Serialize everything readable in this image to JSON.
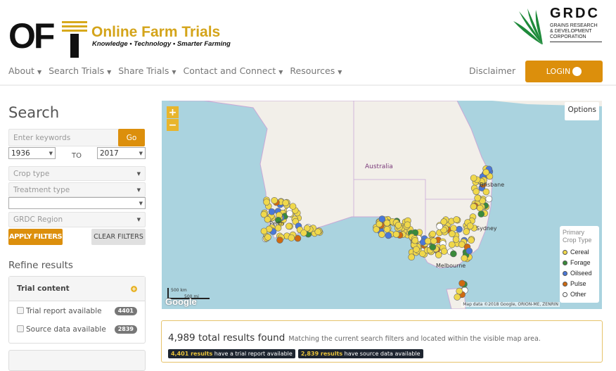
{
  "header": {
    "logo_text": "OFT",
    "title": "Online Farm Trials",
    "tagline": "Knowledge • Technology • Smarter Farming",
    "partner": {
      "name": "GRDC",
      "subtitle": [
        "GRAINS RESEARCH",
        "& DEVELOPMENT",
        "CORPORATION"
      ]
    }
  },
  "nav": {
    "items": [
      {
        "label": "About"
      },
      {
        "label": "Search Trials"
      },
      {
        "label": "Share Trials"
      },
      {
        "label": "Contact and Connect"
      },
      {
        "label": "Resources"
      }
    ],
    "disclaimer": "Disclaimer",
    "login": "LOGIN"
  },
  "search": {
    "title": "Search",
    "keyword_placeholder": "Enter keywords",
    "go": "Go",
    "year_from": "1936",
    "to_label": "TO",
    "year_to": "2017",
    "crop_type": "Crop type",
    "treatment_type": "Treatment type",
    "blank_select": "",
    "region": "GRDC Region",
    "apply": "APPLY FILTERS",
    "clear": "CLEAR FILTERS"
  },
  "refine": {
    "title": "Refine results",
    "panel_title": "Trial content",
    "options": [
      {
        "label": "Trial report available",
        "count": "4401"
      },
      {
        "label": "Source data available",
        "count": "2839"
      }
    ]
  },
  "map": {
    "zoom_in": "+",
    "zoom_out": "−",
    "options": "Options",
    "labels": {
      "country": "Australia",
      "perth": "Perth",
      "brisbane": "Brisbane",
      "sydney": "Sydney",
      "melbourne": "Melbourne"
    },
    "scale_km": "500 km",
    "scale_mi": "500 mi",
    "google": "Google",
    "attribution": "Map data ©2018 Google, ORION-ME, ZENRIN",
    "legend": {
      "title": "Primary Crop Type",
      "items": [
        {
          "label": "Cereal",
          "color": "#f0d84a"
        },
        {
          "label": "Forage",
          "color": "#3a8a3a"
        },
        {
          "label": "Oilseed",
          "color": "#4a78d8"
        },
        {
          "label": "Pulse",
          "color": "#d06a10"
        },
        {
          "label": "Other",
          "color": "#ffffff"
        }
      ]
    }
  },
  "results": {
    "total": "4,989 total results found",
    "note": "Matching the current search filters and located within the visible map area.",
    "report_count": "4,401 results",
    "report_text": "have a trial report available",
    "source_count": "2,839 results",
    "source_text": "have source data available"
  },
  "colors": {
    "accent": "#dc8f0c",
    "brand_gold": "#d4a41a"
  }
}
